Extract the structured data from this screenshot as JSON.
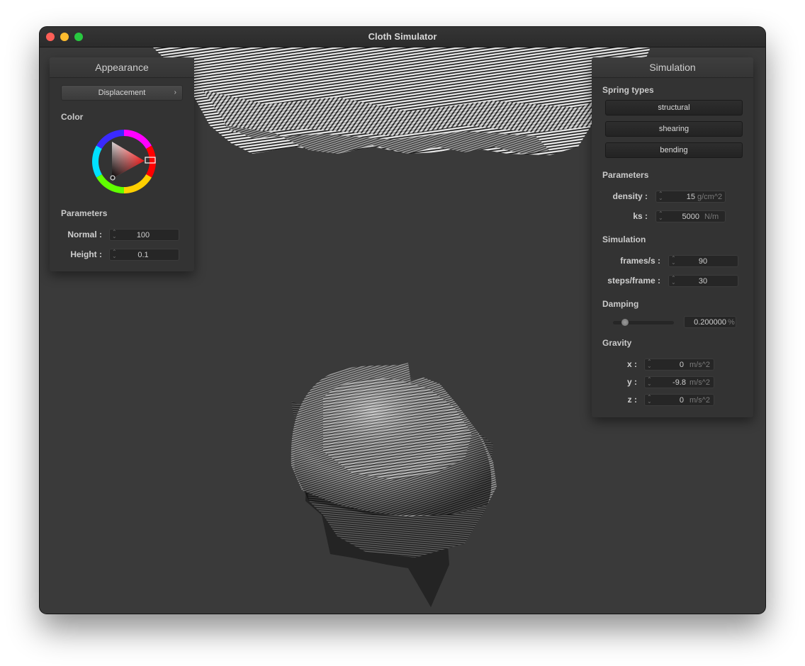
{
  "window": {
    "title": "Cloth Simulator"
  },
  "appearance": {
    "header": "Appearance",
    "shader_dropdown": {
      "value": "Displacement"
    },
    "color_label": "Color",
    "parameters_label": "Parameters",
    "normal": {
      "label": "Normal :",
      "value": "100"
    },
    "height": {
      "label": "Height :",
      "value": "0.1"
    }
  },
  "simulation": {
    "header": "Simulation",
    "spring_types_label": "Spring types",
    "spring_buttons": {
      "structural": "structural",
      "shearing": "shearing",
      "bending": "bending"
    },
    "parameters_label": "Parameters",
    "density": {
      "label": "density :",
      "value": "15",
      "unit": "g/cm^2"
    },
    "ks": {
      "label": "ks :",
      "value": "5000",
      "unit": "N/m"
    },
    "simulation_label": "Simulation",
    "frames_per_s": {
      "label": "frames/s :",
      "value": "90"
    },
    "steps_per_frame": {
      "label": "steps/frame :",
      "value": "30"
    },
    "damping_label": "Damping",
    "damping": {
      "value": "0.200000",
      "unit": "%",
      "slider_fraction": 0.2
    },
    "gravity_label": "Gravity",
    "gravity_x": {
      "label": "x :",
      "value": "0",
      "unit": "m/s^2"
    },
    "gravity_y": {
      "label": "y :",
      "value": "-9.8",
      "unit": "m/s^2"
    },
    "gravity_z": {
      "label": "z :",
      "value": "0",
      "unit": "m/s^2"
    }
  },
  "icons": {
    "spinner": "spinner-arrows-icon",
    "chevron": "chevron-right-icon"
  }
}
